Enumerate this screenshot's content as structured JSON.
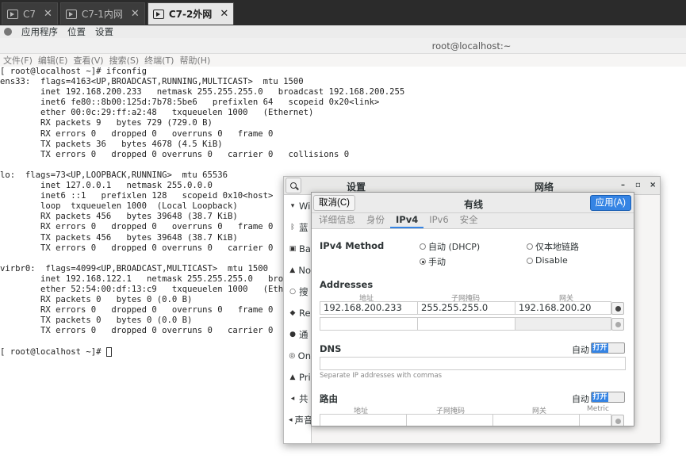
{
  "vm_tabs": [
    {
      "label": "C7"
    },
    {
      "label": "C7-1内网"
    },
    {
      "label": "C7-2外网"
    }
  ],
  "topbar": {
    "apps": "应用程序",
    "places": "位置",
    "settings": "设置"
  },
  "terminal": {
    "title": "root@localhost:~",
    "menu": [
      "文件(F)",
      "编辑(E)",
      "查看(V)",
      "搜索(S)",
      "终端(T)",
      "帮助(H)"
    ],
    "lines": [
      "[ root@localhost ~]# ifconfig",
      "ens33:  flags=4163<UP,BROADCAST,RUNNING,MULTICAST>  mtu 1500",
      "        inet 192.168.200.233   netmask 255.255.255.0   broadcast 192.168.200.255",
      "        inet6 fe80::8b00:125d:7b78:5be6   prefixlen 64   scopeid 0x20<link>",
      "        ether 00:0c:29:ff:a2:48   txqueuelen 1000   (Ethernet)",
      "        RX packets 9   bytes 729 (729.0 B)",
      "        RX errors 0   dropped 0   overruns 0   frame 0",
      "        TX packets 36   bytes 4678 (4.5 KiB)",
      "        TX errors 0   dropped 0 overruns 0   carrier 0   collisions 0",
      "",
      "lo:  flags=73<UP,LOOPBACK,RUNNING>  mtu 65536",
      "        inet 127.0.0.1   netmask 255.0.0.0",
      "        inet6 ::1   prefixlen 128   scopeid 0x10<host>",
      "        loop  txqueuelen 1000  (Local Loopback)",
      "        RX packets 456   bytes 39648 (38.7 KiB)",
      "        RX errors 0   dropped 0   overruns 0   frame 0",
      "        TX packets 456   bytes 39648 (38.7 KiB)",
      "        TX errors 0   dropped 0 overruns 0   carrier 0   col",
      "",
      "virbr0:  flags=4099<UP,BROADCAST,MULTICAST>  mtu 1500",
      "        inet 192.168.122.1   netmask 255.255.255.0   broad",
      "        ether 52:54:00:df:13:c9   txqueuelen 1000   (Ether",
      "        RX packets 0   bytes 0 (0.0 B)",
      "        RX errors 0   dropped 0   overruns 0   frame 0",
      "        TX packets 0   bytes 0 (0.0 B)",
      "        TX errors 0   dropped 0 overruns 0   carrier 0   col",
      ""
    ],
    "prompt": "[ root@localhost ~]# "
  },
  "settings": {
    "title": "设置",
    "network_title": "网络",
    "window_controls": [
      "–",
      "▫",
      "×"
    ],
    "sidebar": [
      {
        "label": "Wi",
        "icon": "wifi-icon",
        "glyph": "▾"
      },
      {
        "label": "蓝",
        "icon": "bluetooth-icon",
        "glyph": "ᛒ"
      },
      {
        "label": "Ba",
        "icon": "background-icon",
        "glyph": "▣"
      },
      {
        "label": "No",
        "icon": "notifications-icon",
        "glyph": "▲"
      },
      {
        "label": "搜",
        "icon": "search-icon",
        "glyph": "○"
      },
      {
        "label": "Re",
        "icon": "region-icon",
        "glyph": "◆"
      },
      {
        "label": "通",
        "icon": "universal-access-icon",
        "glyph": "●"
      },
      {
        "label": "On",
        "icon": "online-accounts-icon",
        "glyph": "◎"
      },
      {
        "label": "Pri",
        "icon": "privacy-icon",
        "glyph": "▲"
      },
      {
        "label": "共",
        "icon": "sharing-icon",
        "glyph": "◂"
      },
      {
        "label": "声音",
        "icon": "sound-icon",
        "glyph": "◂"
      }
    ]
  },
  "dialog": {
    "cancel": "取消(C)",
    "title": "有线",
    "apply": "应用(A)",
    "tabs": [
      "详细信息",
      "身份",
      "IPv4",
      "IPv6",
      "安全"
    ],
    "active_tab": "IPv4",
    "ipv4_method_label": "IPv4 Method",
    "methods": [
      {
        "label": "自动 (DHCP)",
        "selected": false
      },
      {
        "label": "仅本地链路",
        "selected": false
      },
      {
        "label": "手动",
        "selected": true
      },
      {
        "label": "Disable",
        "selected": false
      }
    ],
    "addresses_label": "Addresses",
    "addr_cols": [
      "地址",
      "子网掩码",
      "网关"
    ],
    "addresses": [
      [
        "192.168.200.233",
        "255.255.255.0",
        "192.168.200.20"
      ],
      [
        "",
        "",
        ""
      ]
    ],
    "dns_label": "DNS",
    "auto_label": "自动",
    "toggle_on": "打开",
    "dns_hint": "Separate IP addresses with commas",
    "routes_label": "路由",
    "route_cols": [
      "地址",
      "子网掩码",
      "网关",
      "Metric"
    ],
    "accent_color": "#3584e4"
  }
}
